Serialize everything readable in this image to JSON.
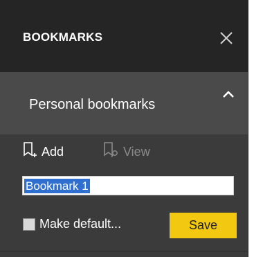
{
  "header": {
    "title": "BOOKMARKS",
    "close_icon": "close-icon"
  },
  "section": {
    "title": "Personal bookmarks",
    "toggle_icon": "chevron-up-icon"
  },
  "toolbar": {
    "add_label": "Add",
    "add_icon": "add-bookmark-icon",
    "view_label": "View",
    "view_icon": "view-bookmark-icon"
  },
  "bookmark_input": {
    "value": "Bookmark 1"
  },
  "make_default": {
    "label": "Make default...",
    "checked": false
  },
  "save_label": "Save",
  "colors": {
    "header_bg": "#252525",
    "panel_bg": "#3b3b3b",
    "section_bg": "#4a4a4a",
    "accent": "#f2c811",
    "selection": "#2f6fd0"
  }
}
